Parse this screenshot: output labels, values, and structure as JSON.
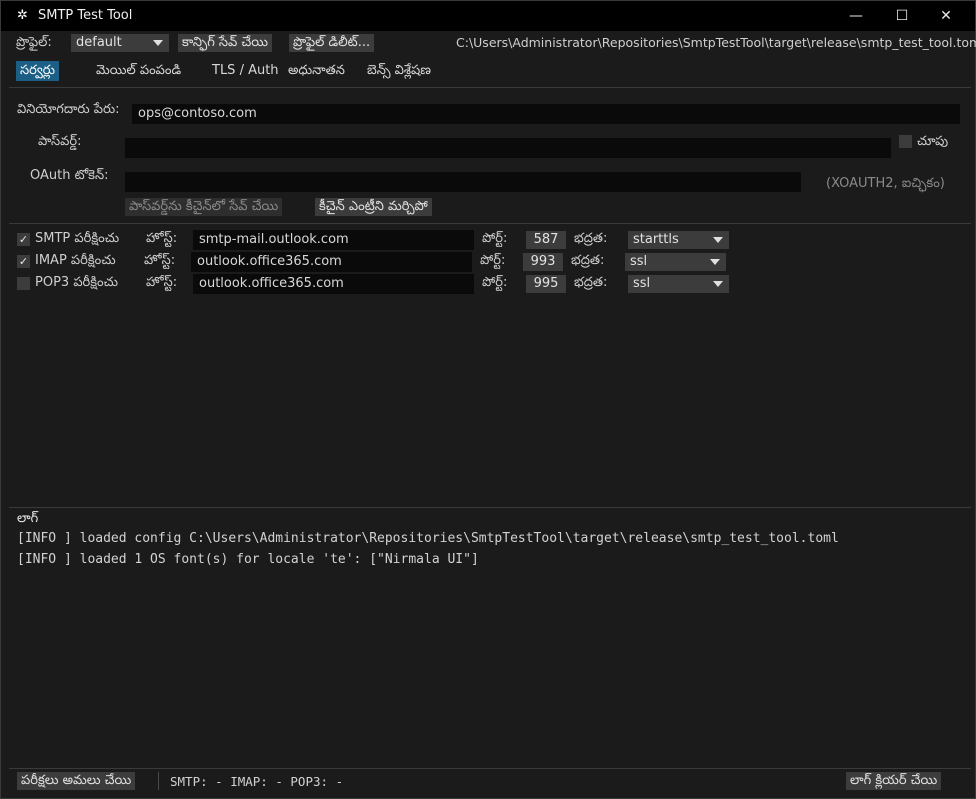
{
  "window": {
    "title": "SMTP Test Tool",
    "minimize_glyph": "—",
    "maximize_glyph": "☐",
    "close_glyph": "✕",
    "app_icon": "✲"
  },
  "toolbar": {
    "profile_label": "ప్రొఫైల్:",
    "profile_value": "default",
    "save_config_label": "కాన్ఫిగ్ సేవ్ చేయి",
    "delete_profile_label": "ప్రొఫైల్ డిలీట్...",
    "config_path": "C:\\Users\\Administrator\\Repositories\\SmtpTestTool\\target\\release\\smtp_test_tool.toml"
  },
  "tabs": [
    {
      "label": "సర్వర్లు",
      "active": true
    },
    {
      "label": "మెయిల్ పంపండి",
      "active": false
    },
    {
      "label": "TLS / Auth",
      "active": false
    },
    {
      "label": "అధునాతన",
      "active": false
    },
    {
      "label": "బెన్స్ విశ్లేషణ",
      "active": false
    }
  ],
  "auth": {
    "username_label": "వినియోగదారు పేరు:",
    "username_value": "ops@contoso.com",
    "password_label": "పాస్‌వర్డ్:",
    "password_value": "",
    "show_label": "చూపు",
    "oauth_label": "OAuth టోకెన్:",
    "oauth_value": "",
    "oauth_hint": "(XOAUTH2, ఐచ్ఛికం)",
    "save_keychain_label": "పాస్‌వర్డ్‌ను కీచైన్‌లో సేవ్ చేయి",
    "forget_keychain_label": "కీచైన్ ఎంట్రీని మర్చిపో"
  },
  "servers": [
    {
      "name": "SMTP పరీక్షించు",
      "checked": true,
      "host_label": "హోస్ట్:",
      "host": "smtp-mail.outlook.com",
      "port_label": "పోర్ట్:",
      "port": "587",
      "security_label": "భద్రత:",
      "security": "starttls"
    },
    {
      "name": "IMAP పరీక్షించు",
      "checked": true,
      "host_label": "హోస్ట్:",
      "host": "outlook.office365.com",
      "port_label": "పోర్ట్:",
      "port": "993",
      "security_label": "భద్రత:",
      "security": "ssl"
    },
    {
      "name": "POP3 పరీక్షించు",
      "checked": false,
      "host_label": "హోస్ట్:",
      "host": "outlook.office365.com",
      "port_label": "పోర్ట్:",
      "port": "995",
      "security_label": "భద్రత:",
      "security": "ssl"
    }
  ],
  "log": {
    "title": "లాగ్",
    "lines": [
      "[INFO ] loaded config C:\\Users\\Administrator\\Repositories\\SmtpTestTool\\target\\release\\smtp_test_tool.toml",
      "[INFO ] loaded 1 OS font(s) for locale 'te': [\"Nirmala UI\"]"
    ]
  },
  "statusbar": {
    "run_tests_label": "పరీక్షలు అమలు చేయి",
    "status_text": "SMTP: - IMAP: - POP3: -",
    "clear_log_label": "లాగ్ క్లియర్ చేయి"
  },
  "colors": {
    "accent": "#1c5f86",
    "background": "#1b1b1b",
    "titlebar": "#000000"
  }
}
